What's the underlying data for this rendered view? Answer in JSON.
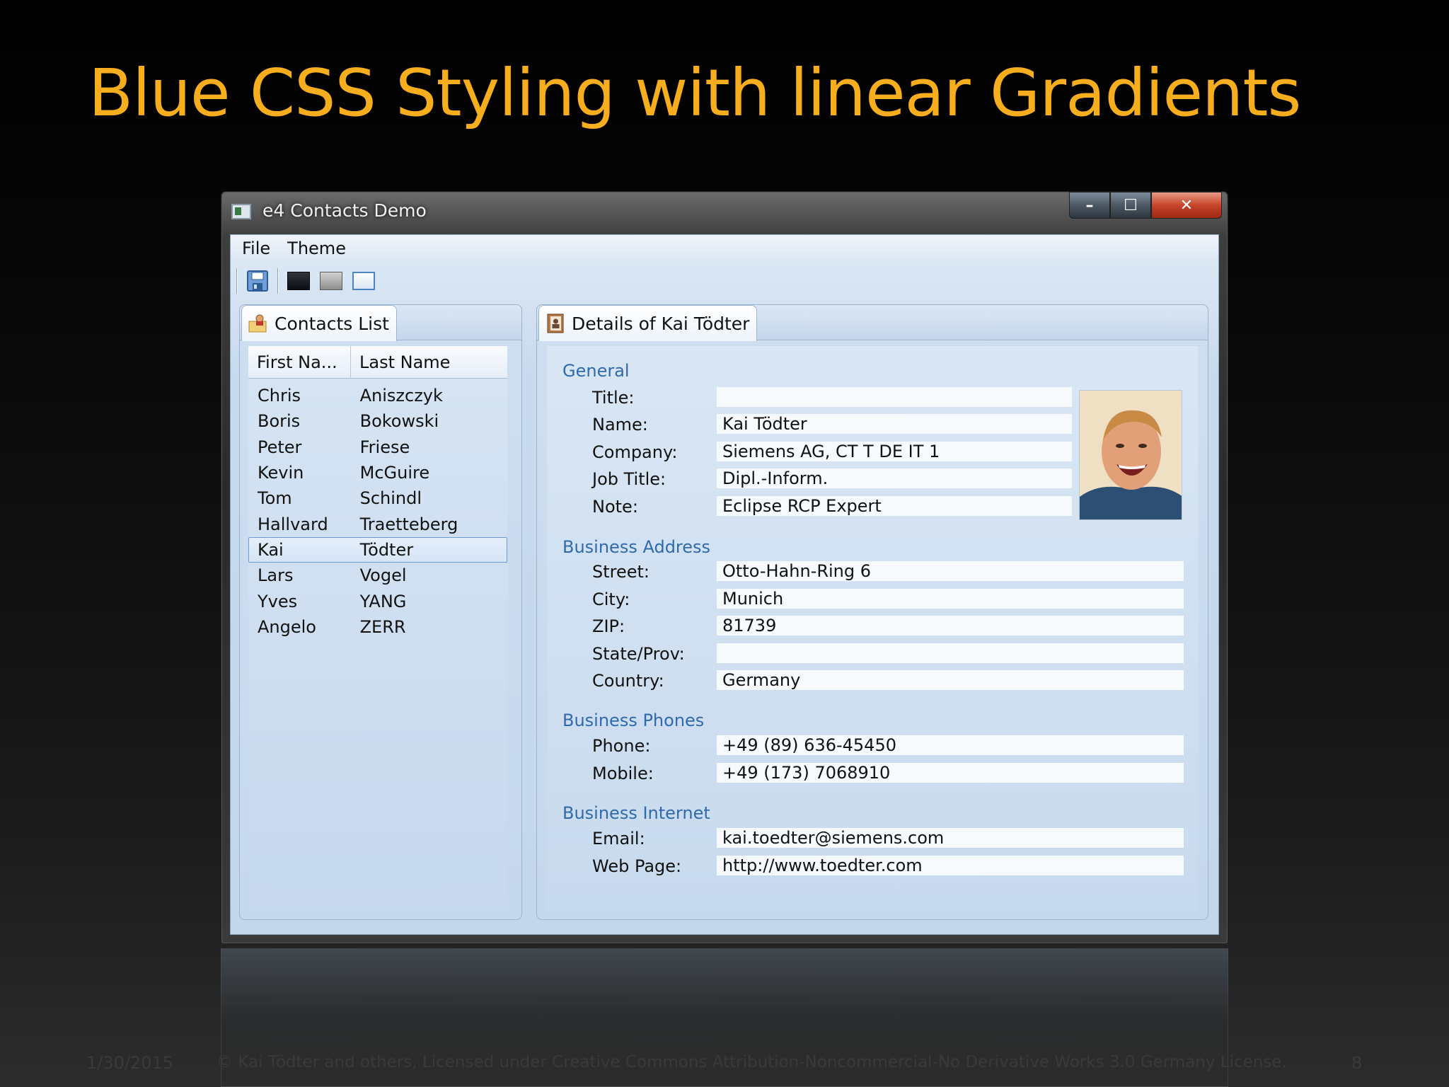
{
  "slide": {
    "title": "Blue CSS Styling with linear Gradients",
    "footer_date": "1/30/2015",
    "footer_text": "© Kai Tödter and others, Licensed under Creative Commons Attribution-Noncommercial-No Derivative Works 3.0 Germany License.",
    "page_number": "8",
    "title_color": "#f6ad1e"
  },
  "window": {
    "title": "e4 Contacts Demo",
    "controls": {
      "minimize": "–",
      "maximize": "☐",
      "close": "✕"
    }
  },
  "menu": {
    "items": [
      "File",
      "Theme"
    ]
  },
  "toolbar": {
    "icons": [
      "save-icon",
      "dark-theme-icon",
      "gray-theme-icon",
      "blue-theme-icon"
    ]
  },
  "contacts_panel": {
    "tab_label": "Contacts List",
    "columns": [
      "First Na...",
      "Last Name"
    ],
    "rows": [
      [
        "Chris",
        "Aniszczyk"
      ],
      [
        "Boris",
        "Bokowski"
      ],
      [
        "Peter",
        "Friese"
      ],
      [
        "Kevin",
        "McGuire"
      ],
      [
        "Tom",
        "Schindl"
      ],
      [
        "Hallvard",
        "Traetteberg"
      ],
      [
        "Kai",
        "Tödter"
      ],
      [
        "Lars",
        "Vogel"
      ],
      [
        "Yves",
        "YANG"
      ],
      [
        "Angelo",
        "ZERR"
      ]
    ],
    "selected_index": 6
  },
  "details_panel": {
    "tab_label": "Details of Kai Tödter",
    "sections": {
      "general": "General",
      "address": "Business Address",
      "phones": "Business Phones",
      "internet": "Business Internet"
    },
    "fields": {
      "title": {
        "label": "Title:",
        "value": ""
      },
      "name": {
        "label": "Name:",
        "value": "Kai Tödter"
      },
      "company": {
        "label": "Company:",
        "value": "Siemens AG, CT T DE IT 1"
      },
      "job_title": {
        "label": "Job Title:",
        "value": "Dipl.-Inform."
      },
      "note": {
        "label": "Note:",
        "value": "Eclipse RCP Expert"
      },
      "street": {
        "label": "Street:",
        "value": "Otto-Hahn-Ring 6"
      },
      "city": {
        "label": "City:",
        "value": "Munich"
      },
      "zip": {
        "label": "ZIP:",
        "value": "81739"
      },
      "state": {
        "label": "State/Prov:",
        "value": ""
      },
      "country": {
        "label": "Country:",
        "value": "Germany"
      },
      "phone": {
        "label": "Phone:",
        "value": "+49 (89) 636-45450"
      },
      "mobile": {
        "label": "Mobile:",
        "value": "+49 (173) 7068910"
      },
      "email": {
        "label": "Email:",
        "value": "kai.toedter@siemens.com"
      },
      "web_page": {
        "label": "Web Page:",
        "value": "http://www.toedter.com"
      }
    }
  }
}
